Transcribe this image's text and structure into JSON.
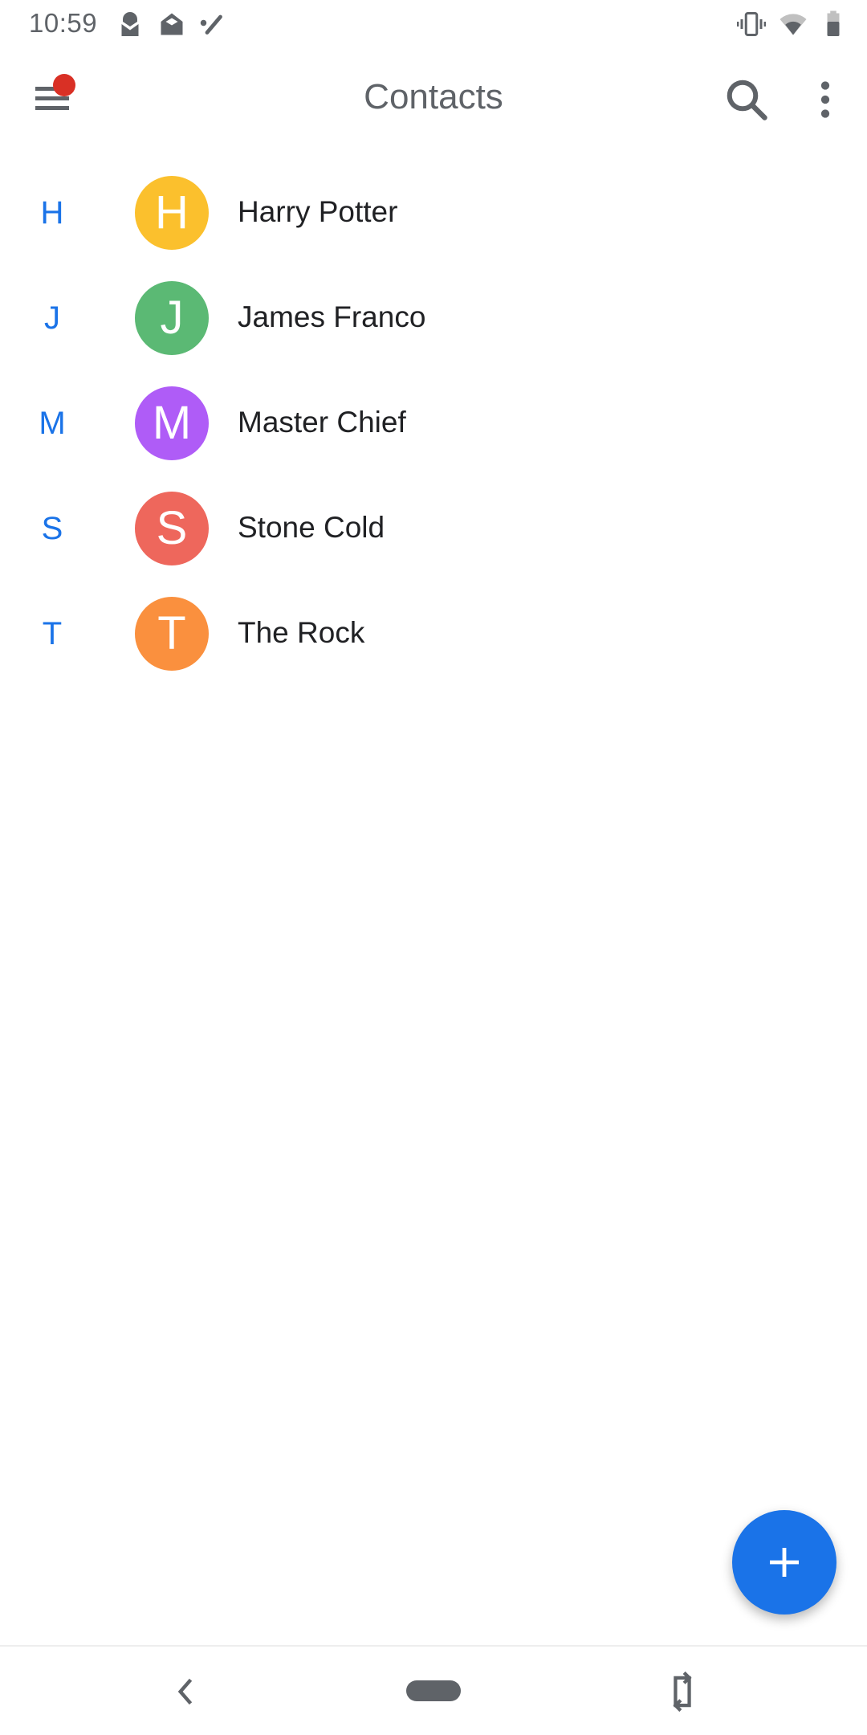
{
  "status_bar": {
    "time": "10:59",
    "left_icons": [
      "protonmail-icon",
      "mail-open-icon",
      "wand-icon"
    ],
    "right_icons": [
      "vibrate-icon",
      "wifi-icon",
      "battery-icon"
    ]
  },
  "toolbar": {
    "title": "Contacts",
    "menu_icon": "menu-icon",
    "has_notification_badge": true,
    "search_icon": "search-icon",
    "more_icon": "more-vert-icon"
  },
  "contacts": [
    {
      "section": "H",
      "initial": "H",
      "name": "Harry Potter",
      "color": "#fbc02d"
    },
    {
      "section": "J",
      "initial": "J",
      "name": "James Franco",
      "color": "#5bb974"
    },
    {
      "section": "M",
      "initial": "M",
      "name": "Master Chief",
      "color": "#af5cf7"
    },
    {
      "section": "S",
      "initial": "S",
      "name": "Stone Cold",
      "color": "#ee675c"
    },
    {
      "section": "T",
      "initial": "T",
      "name": "The Rock",
      "color": "#fa903e"
    }
  ],
  "fab": {
    "icon": "add-icon",
    "color": "#1a73e8"
  },
  "colors": {
    "accent": "#1a73e8",
    "badge": "#d93025",
    "icon_gray": "#5f6368"
  },
  "nav_bar": {
    "back_icon": "back-icon",
    "home_icon": "home-pill-icon",
    "rotate_icon": "rotate-screen-icon"
  }
}
